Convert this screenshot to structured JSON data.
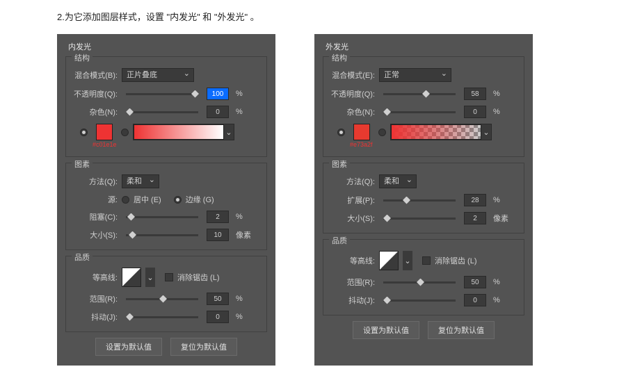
{
  "instruction": "2.为它添加图层样式，设置 \"内发光\" 和 \"外发光\" 。",
  "inner": {
    "title": "内发光",
    "structure": {
      "title": "结构",
      "blend_label": "混合模式(B):",
      "blend_value": "正片叠底",
      "opacity_label": "不透明度(Q):",
      "opacity_value": "100",
      "pct": "%",
      "noise_label": "杂色(N):",
      "noise_value": "0",
      "hex": "#c01e1e"
    },
    "elements": {
      "title": "图素",
      "technique_label": "方法(Q):",
      "technique_value": "柔和",
      "source_label": "源:",
      "center": "居中 (E)",
      "edge": "边缘 (G)",
      "choke_label": "阻塞(C):",
      "choke_value": "2",
      "size_label": "大小(S):",
      "size_value": "10",
      "px": "像素"
    },
    "quality": {
      "title": "品质",
      "contour_label": "等高线:",
      "antialias": "消除锯齿 (L)",
      "range_label": "范围(R):",
      "range_value": "50",
      "jitter_label": "抖动(J):",
      "jitter_value": "0"
    }
  },
  "outer": {
    "title": "外发光",
    "structure": {
      "title": "结构",
      "blend_label": "混合模式(E):",
      "blend_value": "正常",
      "opacity_label": "不透明度(Q):",
      "opacity_value": "58",
      "pct": "%",
      "noise_label": "杂色(N):",
      "noise_value": "0",
      "hex": "#e73a2f"
    },
    "elements": {
      "title": "图素",
      "technique_label": "方法(Q):",
      "technique_value": "柔和",
      "spread_label": "扩展(P):",
      "spread_value": "28",
      "size_label": "大小(S):",
      "size_value": "2",
      "px": "像素"
    },
    "quality": {
      "title": "品质",
      "contour_label": "等高线:",
      "antialias": "消除锯齿 (L)",
      "range_label": "范围(R):",
      "range_value": "50",
      "jitter_label": "抖动(J):",
      "jitter_value": "0"
    }
  },
  "buttons": {
    "set_default": "设置为默认值",
    "reset_default": "复位为默认值"
  }
}
